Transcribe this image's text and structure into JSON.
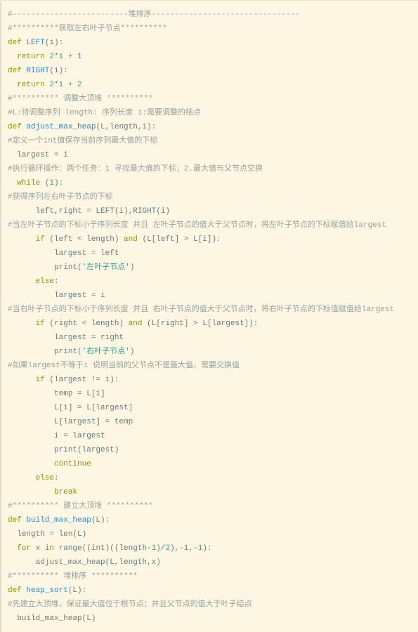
{
  "colors": {
    "background": "#fdf6e3",
    "keyword": "#859900",
    "function": "#268bd2",
    "number": "#2aa198",
    "string": "#2aa198",
    "comment": "#93a1a1",
    "text": "#657b83"
  },
  "code": {
    "lines": [
      [
        [
          "c",
          "#-------------------------堆排序--------------------------------"
        ]
      ],
      [
        [
          "c",
          "#**********获取左右叶子节点**********"
        ]
      ],
      [
        [
          "k",
          "def "
        ],
        [
          "f",
          "LEFT"
        ],
        [
          "p",
          "(i):"
        ]
      ],
      [
        [
          "p",
          "  "
        ],
        [
          "k",
          "return "
        ],
        [
          "n",
          "2"
        ],
        [
          "p",
          "*i + "
        ],
        [
          "n",
          "1"
        ]
      ],
      [
        [
          "k",
          "def "
        ],
        [
          "f",
          "RIGHT"
        ],
        [
          "p",
          "(i):"
        ]
      ],
      [
        [
          "p",
          "  "
        ],
        [
          "k",
          "return "
        ],
        [
          "n",
          "2"
        ],
        [
          "p",
          "*i + "
        ],
        [
          "n",
          "2"
        ]
      ],
      [
        [
          "c",
          "#********** 调整大顶堆 **********"
        ]
      ],
      [
        [
          "c",
          "#L:待调整序列 length: 序列长度 i:需要调整的结点"
        ]
      ],
      [
        [
          "k",
          "def "
        ],
        [
          "f",
          "adjust_max_heap"
        ],
        [
          "p",
          "(L,length,i):"
        ]
      ],
      [
        [
          "c",
          "#定义一个int值保存当前序列最大值的下标"
        ]
      ],
      [
        [
          "p",
          "  largest = i"
        ]
      ],
      [
        [
          "c",
          "#执行循环操作：两个任务：1 寻找最大值的下标；2.最大值与父节点交换"
        ]
      ],
      [
        [
          "p",
          "  "
        ],
        [
          "k",
          "while"
        ],
        [
          "p",
          " ("
        ],
        [
          "n",
          "1"
        ],
        [
          "p",
          "):"
        ]
      ],
      [
        [
          "c",
          "#获得序列左右叶子节点的下标"
        ]
      ],
      [
        [
          "p",
          "      left,right = LEFT(i),RIGHT(i)"
        ]
      ],
      [
        [
          "c",
          "#当左叶子节点的下标小于序列长度 并且 左叶子节点的值大于父节点时，将左叶子节点的下标赋值给largest"
        ]
      ],
      [
        [
          "p",
          "      "
        ],
        [
          "k",
          "if"
        ],
        [
          "p",
          " (left < length) "
        ],
        [
          "k",
          "and"
        ],
        [
          "p",
          " (L[left] > L[i]):"
        ]
      ],
      [
        [
          "p",
          "          largest = left"
        ]
      ],
      [
        [
          "p",
          "          print("
        ],
        [
          "s",
          "'左叶子节点'"
        ],
        [
          "p",
          ")"
        ]
      ],
      [
        [
          "p",
          "      "
        ],
        [
          "k",
          "else"
        ],
        [
          "p",
          ":"
        ]
      ],
      [
        [
          "p",
          "          largest = i"
        ]
      ],
      [
        [
          "c",
          "#当右叶子节点的下标小于序列长度 并且 右叶子节点的值大于父节点时，将右叶子节点的下标值赋值给largest"
        ]
      ],
      [
        [
          "p",
          "      "
        ],
        [
          "k",
          "if"
        ],
        [
          "p",
          " (right < length) "
        ],
        [
          "k",
          "and"
        ],
        [
          "p",
          " (L[right] > L[largest]):"
        ]
      ],
      [
        [
          "p",
          "          largest = right"
        ]
      ],
      [
        [
          "p",
          "          print("
        ],
        [
          "s",
          "'右叶子节点'"
        ],
        [
          "p",
          ")"
        ]
      ],
      [
        [
          "c",
          "#如果largest不等于i 说明当前的父节点不是最大值，需要交换值"
        ]
      ],
      [
        [
          "p",
          "      "
        ],
        [
          "k",
          "if"
        ],
        [
          "p",
          " (largest != i):"
        ]
      ],
      [
        [
          "p",
          "          temp = L[i]"
        ]
      ],
      [
        [
          "p",
          "          L[i] = L[largest]"
        ]
      ],
      [
        [
          "p",
          "          L[largest] = temp"
        ]
      ],
      [
        [
          "p",
          "          i = largest"
        ]
      ],
      [
        [
          "p",
          "          print(largest)"
        ]
      ],
      [
        [
          "p",
          "          "
        ],
        [
          "k",
          "continue"
        ]
      ],
      [
        [
          "p",
          "      "
        ],
        [
          "k",
          "else"
        ],
        [
          "p",
          ":"
        ]
      ],
      [
        [
          "p",
          "          "
        ],
        [
          "k",
          "break"
        ]
      ],
      [
        [
          "c",
          "#********** 建立大顶堆 **********"
        ]
      ],
      [
        [
          "k",
          "def "
        ],
        [
          "f",
          "build_max_heap"
        ],
        [
          "p",
          "(L):"
        ]
      ],
      [
        [
          "p",
          "  length = len(L)"
        ]
      ],
      [
        [
          "p",
          "  "
        ],
        [
          "k",
          "for"
        ],
        [
          "p",
          " x "
        ],
        [
          "k",
          "in"
        ],
        [
          "p",
          " range((int)((length-"
        ],
        [
          "n",
          "1"
        ],
        [
          "p",
          ")/"
        ],
        [
          "n",
          "2"
        ],
        [
          "p",
          "),-"
        ],
        [
          "n",
          "1"
        ],
        [
          "p",
          ",-"
        ],
        [
          "n",
          "1"
        ],
        [
          "p",
          "):"
        ]
      ],
      [
        [
          "p",
          "      adjust_max_heap(L,length,x)"
        ]
      ],
      [
        [
          "c",
          "#********** 堆排序 **********"
        ]
      ],
      [
        [
          "k",
          "def "
        ],
        [
          "f",
          "heap_sort"
        ],
        [
          "p",
          "(L):"
        ]
      ],
      [
        [
          "c",
          "#先建立大顶堆，保证最大值位于根节点；并且父节点的值大于叶子结点"
        ]
      ],
      [
        [
          "p",
          "  build_max_heap(L)"
        ]
      ]
    ]
  }
}
